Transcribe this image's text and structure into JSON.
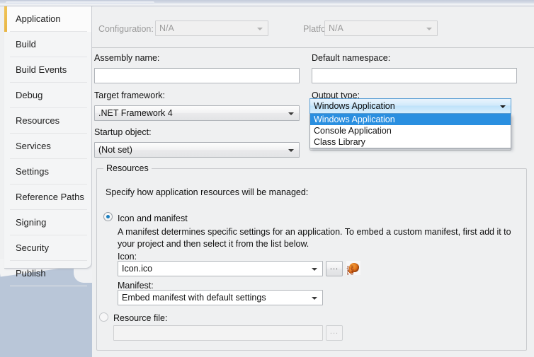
{
  "sidebar": {
    "items": [
      {
        "label": "Application",
        "active": true
      },
      {
        "label": "Build",
        "active": false
      },
      {
        "label": "Build Events",
        "active": false
      },
      {
        "label": "Debug",
        "active": false
      },
      {
        "label": "Resources",
        "active": false
      },
      {
        "label": "Services",
        "active": false
      },
      {
        "label": "Settings",
        "active": false
      },
      {
        "label": "Reference Paths",
        "active": false
      },
      {
        "label": "Signing",
        "active": false
      },
      {
        "label": "Security",
        "active": false
      },
      {
        "label": "Publish",
        "active": false
      }
    ]
  },
  "toolbar": {
    "configuration_label": "Configuration:",
    "configuration_value": "N/A",
    "platform_label": "Platform:",
    "platform_value": "N/A"
  },
  "form": {
    "assembly_name_label": "Assembly name:",
    "assembly_name_value": "",
    "default_namespace_label": "Default namespace:",
    "default_namespace_value": "",
    "target_framework_label": "Target framework:",
    "target_framework_value": ".NET Framework 4",
    "output_type_label": "Output type:",
    "output_type_value": "Windows Application",
    "output_type_options": [
      {
        "label": "Windows Application",
        "selected": true
      },
      {
        "label": "Console Application",
        "selected": false
      },
      {
        "label": "Class Library",
        "selected": false
      }
    ],
    "startup_object_label": "Startup object:",
    "startup_object_value": "(Not set)"
  },
  "resources": {
    "group_title": "Resources",
    "description": "Specify how application resources will be managed:",
    "icon_manifest_radio_label": "Icon and manifest",
    "icon_manifest_help_line1": "A manifest determines specific settings for an application. To embed a custom manifest, first add it to",
    "icon_manifest_help_line2": "your project and then select it from the list below.",
    "icon_label": "Icon:",
    "icon_value": "Icon.ico",
    "icon_browse_label": "...",
    "icon_preview_text": "mario Game",
    "manifest_label": "Manifest:",
    "manifest_value": "Embed manifest with default settings",
    "resource_file_radio_label": "Resource file:",
    "resource_file_value": "",
    "resource_file_browse_label": "..."
  },
  "colors": {
    "accent_tab": "#e8b646",
    "selection_blue": "#2a8fe0",
    "backdrop_blue_gray": "#b9c6d8",
    "window_bg": "#eff0f1"
  }
}
